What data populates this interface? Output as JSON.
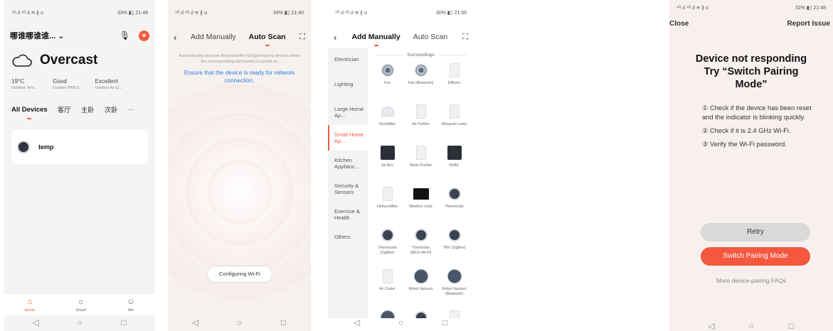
{
  "phone1": {
    "status_left": "⁴ᴳ.ıl ⁴ᴳ.ıl ≋ ∦ ʊ",
    "status_right": "33% ▮▯ 21:46",
    "home_name": "哪谁哪谁谁... ⌄",
    "weather": {
      "condition": "Overcast",
      "stats": [
        {
          "value": "19°C",
          "label": "Outdoor Tem..."
        },
        {
          "value": "Good",
          "label": "Outdoor PM2.5"
        },
        {
          "value": "Excellent",
          "label": "Outdoor Air Q..."
        }
      ]
    },
    "rooms": [
      "All Devices",
      "客厅",
      "主卧",
      "次卧"
    ],
    "more": "···",
    "device_name": "temp",
    "tabs": [
      {
        "label": "Home",
        "icon": "home-icon",
        "glyph": "⌂"
      },
      {
        "label": "Smart",
        "icon": "sun-icon",
        "glyph": "☼"
      },
      {
        "label": "Me",
        "icon": "user-icon",
        "glyph": "☺"
      }
    ]
  },
  "phone2": {
    "status_left": "⁴ᴳ.ıl ⁴ᴳ.ıl ≋ ∦ ʊ",
    "status_right": "34% ▮▯ 21:40",
    "tab_manual": "Add Manually",
    "tab_auto": "Auto Scan",
    "scan_desc": "Automatically discover Bluetooth/Wi-Fi/Zigbee/wired devices when the corresponding permission is turned on",
    "scan_ready": "Ensure that the device is ready for network connection.",
    "config_button": "Configuring Wi-Fi"
  },
  "phone3": {
    "status_left": "⁴ᴳ.ıl ⁴ᴳ.ıl ≋ ∦ ʊ",
    "status_right": "30% ▮▯ 21:56",
    "tab_manual": "Add Manually",
    "tab_auto": "Auto Scan",
    "categories": [
      "Electrician",
      "Lighting",
      "Large Home Ap...",
      "Small Home Ap...",
      "Kitchen Applianc...",
      "Security & Sensors",
      "Exercise & Health",
      "Others"
    ],
    "section": "Surroundings",
    "products": [
      {
        "name": "Fan",
        "shape": "fan"
      },
      {
        "name": "Fan (Bluetooth)",
        "shape": "fan"
      },
      {
        "name": "Diffuser",
        "shape": "box"
      },
      {
        "name": "Humidifier",
        "shape": "dome"
      },
      {
        "name": "Air Purifier",
        "shape": "box"
      },
      {
        "name": "Mosquito Lamp",
        "shape": "box"
      },
      {
        "name": "Air Box",
        "shape": "dark"
      },
      {
        "name": "Water Purifier",
        "shape": "box"
      },
      {
        "name": "HVAC",
        "shape": "dark"
      },
      {
        "name": "Dehumidifier",
        "shape": "box"
      },
      {
        "name": "Weather clock",
        "shape": "screen"
      },
      {
        "name": "Thermostat",
        "shape": "round"
      },
      {
        "name": "Thermostat (ZigBee)",
        "shape": "round"
      },
      {
        "name": "Thermosta t(BLE+Wi-Fi)",
        "shape": "round"
      },
      {
        "name": "TRV (ZigBee)",
        "shape": "round"
      },
      {
        "name": "Air Cooler",
        "shape": "box"
      },
      {
        "name": "Robot Vacuum",
        "shape": "vac"
      },
      {
        "name": "Robot Vacuum (Bluetooth)",
        "shape": "vac"
      },
      {
        "name": "",
        "shape": "vac"
      },
      {
        "name": "",
        "shape": "round"
      },
      {
        "name": "",
        "shape": "box"
      }
    ]
  },
  "phone4": {
    "status_left": "⁴ᴳ.ıl ⁴ᴳ.ıl ≋ ∦ ʊ",
    "status_right": "32% ▮▯ 21:48",
    "close": "Close",
    "report": "Report Issue",
    "headline_1": "Device not responding",
    "headline_2": "Try “Switch Pairing Mode”",
    "tips": [
      "① Check if the device has been reset and the indicator is blinking quickly.",
      "② Check if it is 2.4 GHz Wi-Fi.",
      "③ Verify the Wi-Fi password."
    ],
    "retry": "Retry",
    "switch": "Switch Pairing Mode",
    "faq": "More device-pairing FAQs"
  },
  "sys_nav": {
    "back": "◁",
    "home": "○",
    "recent": "□"
  },
  "colors": {
    "accent": "#f4583e",
    "link": "#2f7fd9"
  }
}
